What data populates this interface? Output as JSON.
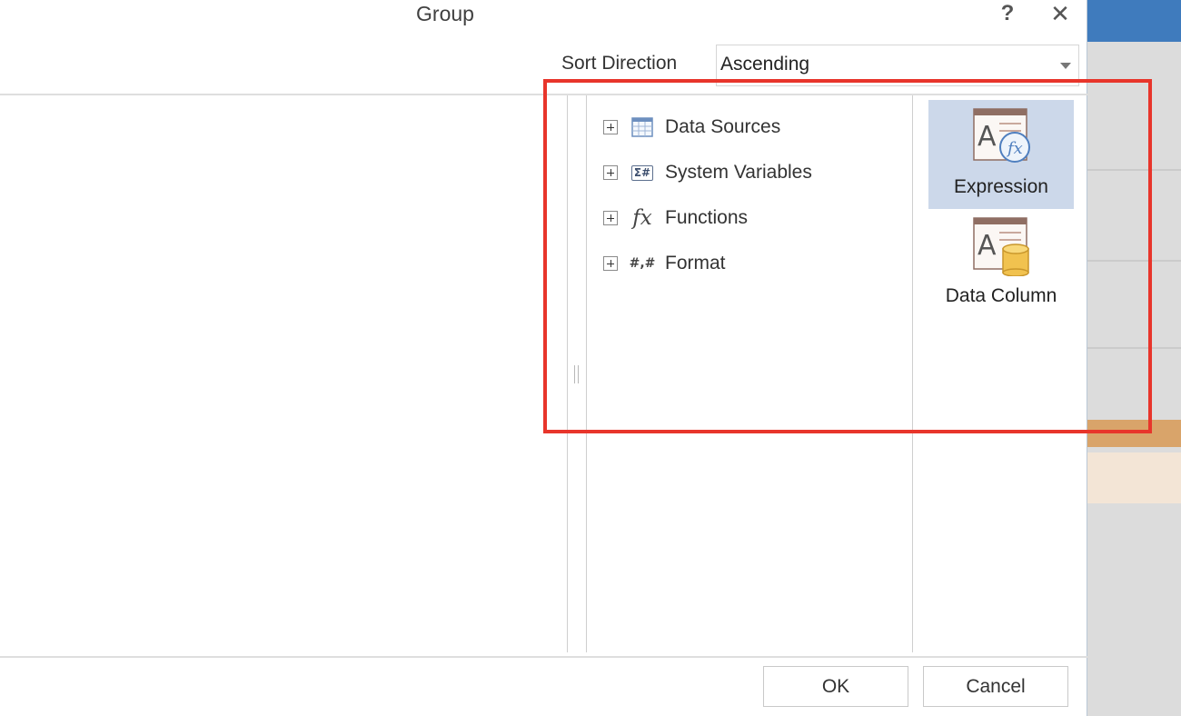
{
  "dialog": {
    "title": "Group",
    "help_label": "?",
    "close_label": "✕"
  },
  "sort": {
    "label": "Sort Direction",
    "value": "Ascending"
  },
  "tree": {
    "items": [
      {
        "label": "Data Sources",
        "icon": "data-sources-icon"
      },
      {
        "label": "System Variables",
        "icon": "system-variables-icon",
        "icon_text": "Σ#"
      },
      {
        "label": "Functions",
        "icon": "functions-icon",
        "icon_text": "fx"
      },
      {
        "label": "Format",
        "icon": "format-icon",
        "icon_text": "#,#"
      }
    ]
  },
  "tools": {
    "expression_label": "Expression",
    "data_column_label": "Data Column"
  },
  "buttons": {
    "ok": "OK",
    "cancel": "Cancel"
  },
  "colors": {
    "highlight_border": "#e8352b",
    "active_tool_bg": "#ccd8ea",
    "background_accent": "#3f7bbd"
  }
}
